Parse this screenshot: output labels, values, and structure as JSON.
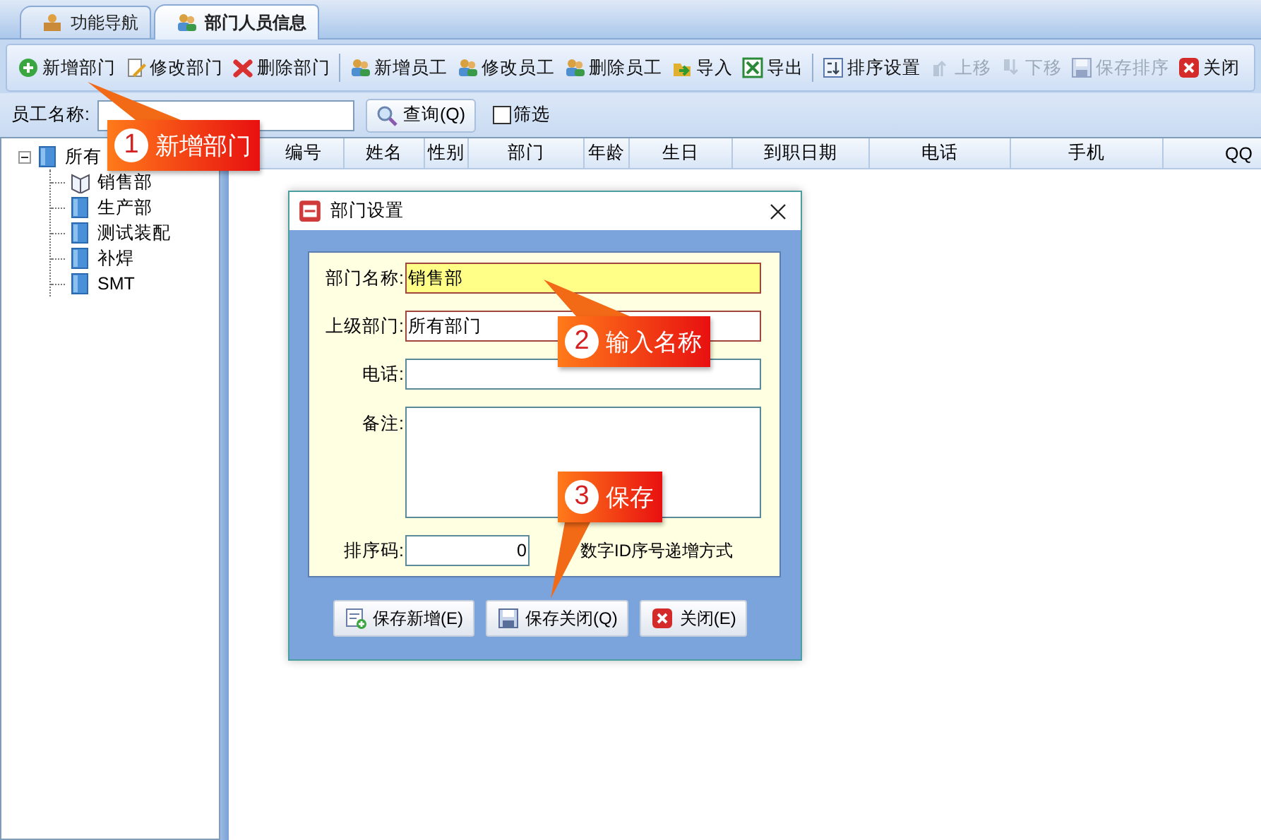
{
  "tabs": [
    {
      "label": "功能导航",
      "selected": false
    },
    {
      "label": "部门人员信息",
      "selected": true
    }
  ],
  "toolbar": {
    "groups": [
      [
        {
          "label": "新增部门",
          "disabled": false
        },
        {
          "label": "修改部门",
          "disabled": false
        },
        {
          "label": "删除部门",
          "disabled": false
        }
      ],
      [
        {
          "label": "新增员工",
          "disabled": false
        },
        {
          "label": "修改员工",
          "disabled": false
        },
        {
          "label": "删除员工",
          "disabled": false
        },
        {
          "label": "导入",
          "disabled": false
        },
        {
          "label": "导出",
          "disabled": false
        }
      ],
      [
        {
          "label": "排序设置",
          "disabled": false
        },
        {
          "label": "上移",
          "disabled": true
        },
        {
          "label": "下移",
          "disabled": true
        },
        {
          "label": "保存排序",
          "disabled": true
        },
        {
          "label": "关闭",
          "disabled": false
        }
      ]
    ]
  },
  "search": {
    "label": "员工名称:",
    "button": "查询(Q)",
    "filter": {
      "label": "筛选",
      "checked": false
    }
  },
  "tree": {
    "label": "所有",
    "expanded": true,
    "children": [
      {
        "label": "销售部",
        "selected": true
      },
      {
        "label": "生产部",
        "selected": false
      },
      {
        "label": "测试装配",
        "selected": false
      },
      {
        "label": "补焊",
        "selected": false
      },
      {
        "label": "SMT",
        "selected": false
      }
    ]
  },
  "table": {
    "columns": [
      "编号",
      "姓名",
      "性别",
      "部门",
      "年龄",
      "生日",
      "到职日期",
      "电话",
      "手机",
      "QQ"
    ]
  },
  "dialog": {
    "title": "部门设置",
    "fields": [
      {
        "label": "部门名称:",
        "kind": "text",
        "value": "销售部",
        "focused": true,
        "required": true
      },
      {
        "label": "上级部门:",
        "kind": "text",
        "value": "所有部门",
        "focused": false,
        "required": true
      },
      {
        "label": "电话:",
        "kind": "text",
        "focused": false,
        "required": false
      },
      {
        "label": "备注:",
        "kind": "textarea",
        "focused": false,
        "required": false
      },
      {
        "label": "排序码:",
        "kind": "number",
        "value": "0",
        "hint": "数字ID序号递增方式",
        "focused": false,
        "required": false
      }
    ],
    "buttons": [
      "保存新增(E)",
      "保存关闭(Q)",
      "关闭(E)"
    ]
  },
  "callouts": [
    {
      "number": "1",
      "text": "新增部门"
    },
    {
      "number": "2",
      "text": "输入名称"
    },
    {
      "number": "3",
      "text": "保存"
    }
  ]
}
